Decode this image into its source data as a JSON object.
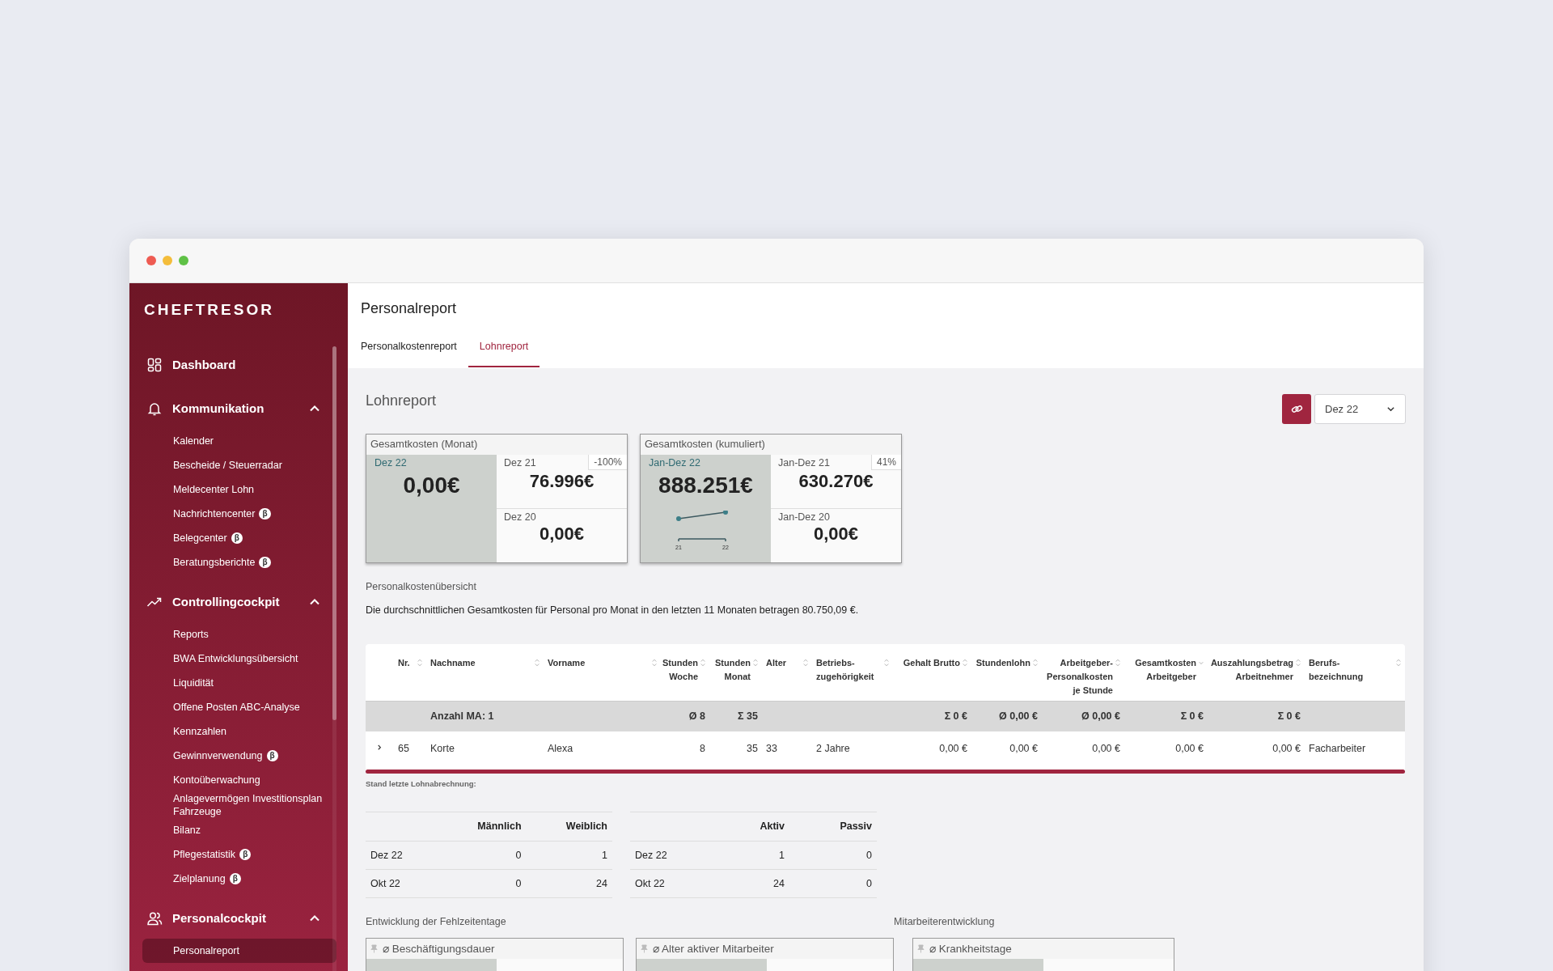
{
  "sidebar": {
    "logo": "CHEFTRESOR",
    "sections": [
      {
        "kind": "link",
        "label": "Dashboard"
      },
      {
        "kind": "group",
        "label": "Kommunikation",
        "expanded": true,
        "items": [
          {
            "label": "Kalender",
            "selected": false
          },
          {
            "label": "Bescheide / Steuerradar",
            "selected": false
          },
          {
            "label": "Meldecenter Lohn",
            "selected": false
          },
          {
            "label": "Nachrichtencenter",
            "badge": "β",
            "selected": false
          },
          {
            "label": "Belegcenter",
            "badge": "β",
            "selected": false
          },
          {
            "label": "Beratungsberichte",
            "badge": "β",
            "selected": false
          }
        ]
      },
      {
        "kind": "group",
        "label": "Controllingcockpit",
        "expanded": true,
        "items": [
          {
            "label": "Reports",
            "selected": false
          },
          {
            "label": "BWA  Entwicklungsübersicht",
            "selected": false
          },
          {
            "label": "Liquidität",
            "selected": false
          },
          {
            "label": "Offene Posten ABC-Analyse",
            "selected": false
          },
          {
            "label": "Kennzahlen",
            "selected": false
          },
          {
            "label": "Gewinnverwendung",
            "badge": "β",
            "selected": false
          },
          {
            "label": "Kontoüberwachung",
            "selected": false
          },
          {
            "label": "Anlagevermögen Investitionsplan Fahrzeuge",
            "selected": false
          },
          {
            "label": "Bilanz",
            "selected": false
          },
          {
            "label": "Pflegestatistik",
            "badge": "β",
            "selected": false
          },
          {
            "label": "Zielplanung",
            "badge": "β",
            "selected": false
          }
        ]
      },
      {
        "kind": "group",
        "label": "Personalcockpit",
        "expanded": true,
        "items": [
          {
            "label": "Personalreport",
            "selected": true
          }
        ]
      }
    ]
  },
  "page": {
    "title": "Personalreport",
    "tabs": [
      {
        "label": "Personalkostenreport",
        "selected": false
      },
      {
        "label": "Lohnreport",
        "selected": true
      }
    ]
  },
  "report": {
    "title": "Lohnreport",
    "period": "Dez 22",
    "kpi_cards": [
      {
        "title": "Gesamtkosten (Monat)",
        "current": {
          "label": "Dez 22",
          "value": "0,00€"
        },
        "comparisons": [
          {
            "label": "Dez 21",
            "value": "76.996€",
            "change": "-100%"
          },
          {
            "label": "Dez 20",
            "value": "0,00€"
          }
        ]
      },
      {
        "title": "Gesamtkosten (kumuliert)",
        "current": {
          "label": "Jan-Dez 22",
          "value": "888.251€"
        },
        "sparkline_labels": [
          "21",
          "22"
        ],
        "comparisons": [
          {
            "label": "Jan-Dez 21",
            "value": "630.270€",
            "change": "41%"
          },
          {
            "label": "Jan-Dez 20",
            "value": "0,00€"
          }
        ]
      }
    ],
    "overview_label": "Personalkostenübersicht",
    "overview_text": "Die durchschnittlichen Gesamtkosten für Personal pro Monat in den letzten 11 Monaten betragen 80.750,09 €.",
    "table": {
      "columns": [
        {
          "label": "Nr.",
          "sorted": false
        },
        {
          "label": "Nachname",
          "total": "Anzahl MA: 1",
          "sorted": false
        },
        {
          "label": "Vorname",
          "sorted": false
        },
        {
          "label": "Stunden\nWoche",
          "total": "Ø 8",
          "sorted": false
        },
        {
          "label": "Stunden\nMonat",
          "total": "Σ 35",
          "sorted": false
        },
        {
          "label": "Alter",
          "sorted": false
        },
        {
          "label": "Betriebs-\nzugehörigkeit",
          "sorted": false
        },
        {
          "label": "Gehalt Brutto",
          "total": "Σ 0 €",
          "sorted": false
        },
        {
          "label": "Stundenlohn",
          "total": "Ø 0,00 €",
          "sorted": false
        },
        {
          "label": "Arbeitgeber-\nPersonalkosten\nje Stunde",
          "total": "Ø 0,00 €",
          "sorted": false
        },
        {
          "label": "Gesamtkosten\nArbeitgeber",
          "total": "Σ 0 €",
          "sorted": true
        },
        {
          "label": "Auszahlungsbetrag\nArbeitnehmer",
          "total": "Σ 0 €",
          "sorted": false
        },
        {
          "label": "Berufs-\nbezeichnung",
          "sorted": false
        }
      ],
      "rows": [
        {
          "expanded": false,
          "cells": [
            "65",
            "Korte",
            "Alexa",
            "8",
            "35",
            "33",
            "2 Jahre",
            "0,00 €",
            "0,00 €",
            "0,00 €",
            "0,00 €",
            "0,00 €",
            "Facharbeiter"
          ]
        }
      ]
    },
    "status_label": "Stand letzte Lohnabrechnung:",
    "headcount_tables": [
      {
        "columns": [
          "Männlich",
          "Weiblich"
        ],
        "rows": [
          {
            "label": "Dez 22",
            "values": [
              "0",
              "1"
            ]
          },
          {
            "label": "Okt 22",
            "values": [
              "0",
              "24"
            ]
          }
        ]
      },
      {
        "columns": [
          "Aktiv",
          "Passiv"
        ],
        "rows": [
          {
            "label": "Dez 22",
            "values": [
              "1",
              "0"
            ]
          },
          {
            "label": "Okt 22",
            "values": [
              "24",
              "0"
            ]
          }
        ]
      }
    ],
    "sections": [
      {
        "title": "Entwicklung der Fehlzeitentage",
        "cards": [
          {
            "title": "⌀ Beschäftigungsdauer"
          },
          {
            "title": "⌀ Alter aktiver Mitarbeiter"
          }
        ]
      },
      {
        "title": "Mitarbeiterentwicklung",
        "cards": [
          {
            "title": "⌀ Krankheitstage"
          }
        ]
      }
    ]
  }
}
